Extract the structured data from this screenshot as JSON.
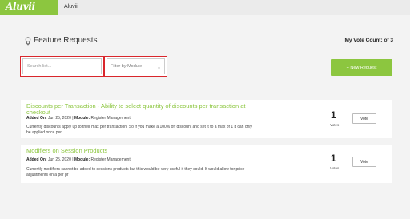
{
  "topbar": {
    "logo": "Aluvii",
    "app_name": "Aluvii"
  },
  "header": {
    "title": "Feature Requests",
    "vote_count_label": "My Vote Count:",
    "vote_count_value": "of 3"
  },
  "filters": {
    "search_placeholder": "Search list...",
    "module_filter": "Filter by Module"
  },
  "actions": {
    "new_request": "+ New Request"
  },
  "requests": [
    {
      "title": "Discounts per Transaction - Ability to select quantity of discounts per transaction at checkout",
      "added_on_label": "Added On:",
      "added_on": "Jun 25, 2020",
      "module_label": "Module:",
      "module": "Register Management",
      "description": "Currently discounts apply up to their max per transaction. So if you make a 100% off discount and set it to a max of 1 it can only be applied once per",
      "votes": "1",
      "votes_label": "Votes",
      "vote_button": "Vote"
    },
    {
      "title": "Modifiers on Session Products",
      "added_on_label": "Added On:",
      "added_on": "Jun 25, 2020",
      "module_label": "Module:",
      "module": "Register Management",
      "description": "Currently modifiers cannot be added to sessions products but this would be very useful if they could. It would allow for price adjustments on a per pr",
      "votes": "1",
      "votes_label": "Votes",
      "vote_button": "Vote"
    }
  ],
  "colors": {
    "brand": "#8cc63f",
    "highlight": "#d9262c"
  },
  "icons": {
    "header": "lightbulb-icon",
    "filter": "chevron-down-icon"
  }
}
